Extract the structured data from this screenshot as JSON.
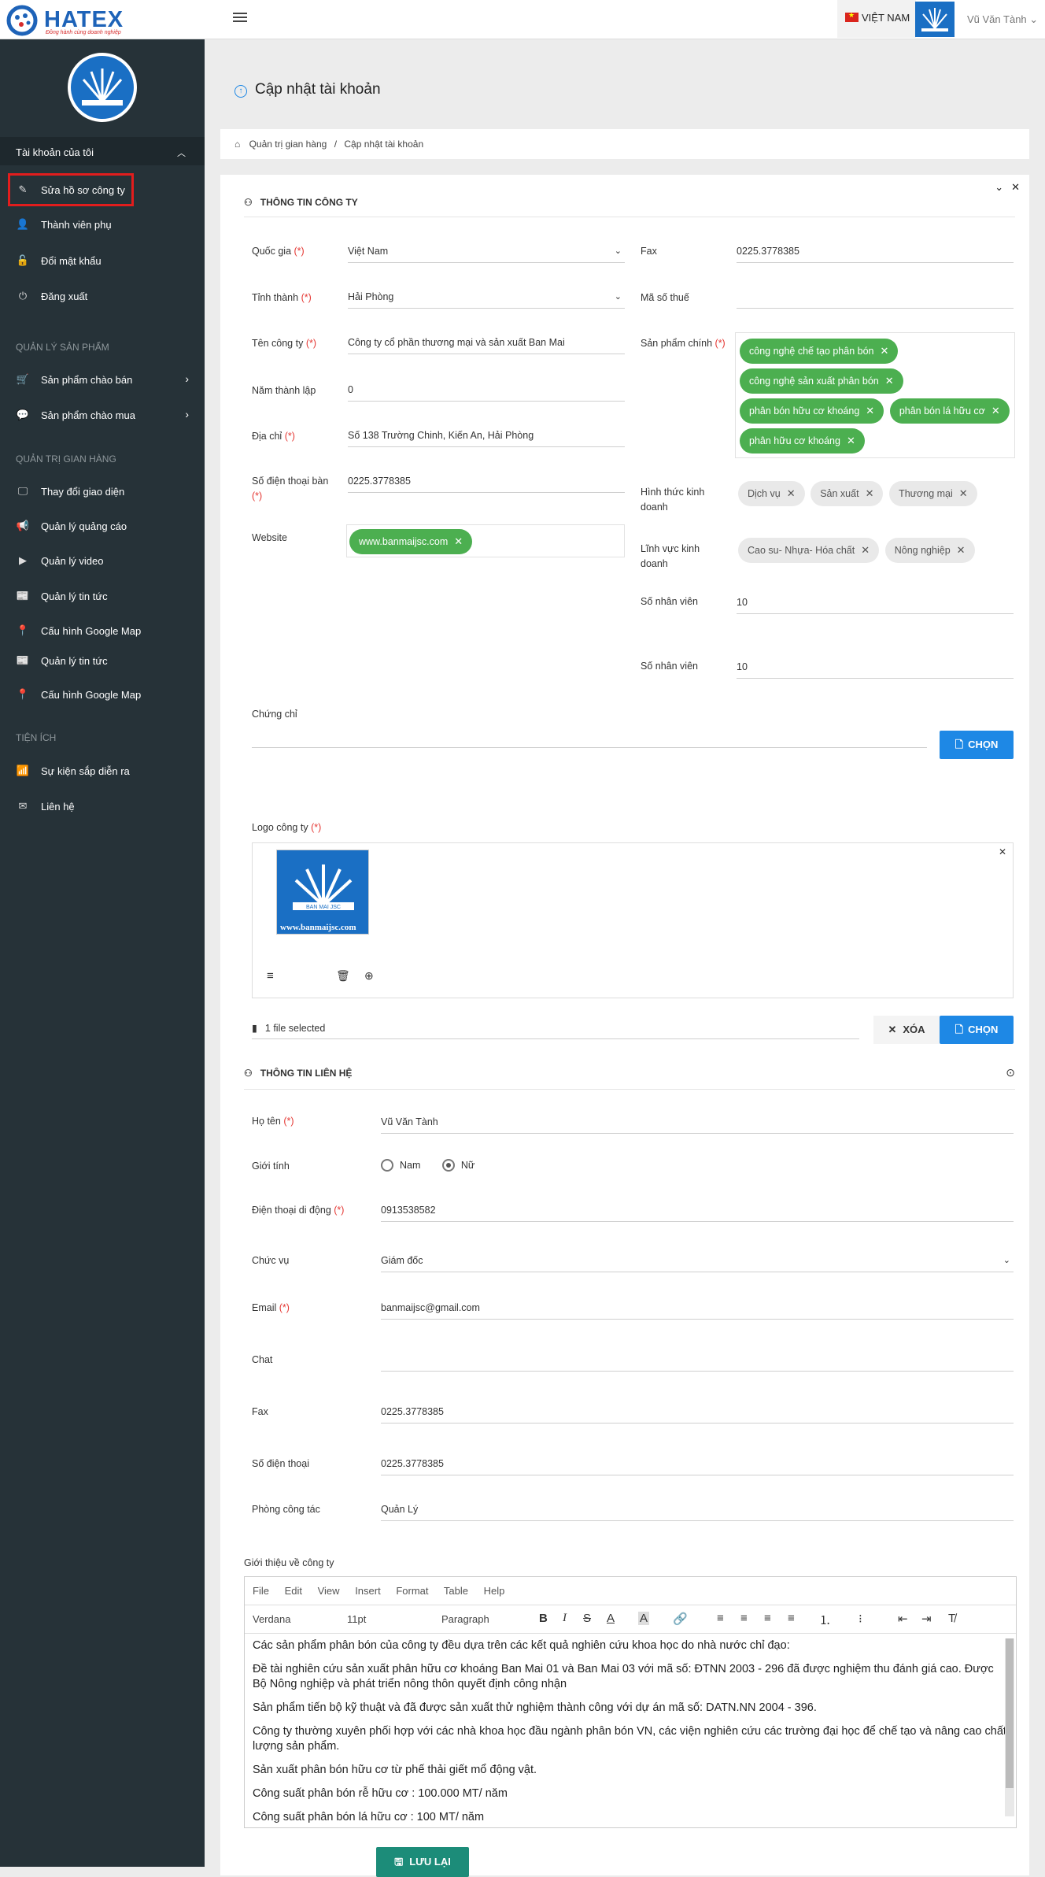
{
  "header": {
    "brand": "HATEX",
    "slogan": "Đồng hành cùng doanh nghiệp",
    "language": "VIỆT NAM",
    "user": "Vũ Văn Tành ⌄"
  },
  "sidebar": {
    "account_title": "Tài khoản của tôi",
    "account_items": [
      "Sửa hồ sơ công ty",
      "Thành viên phụ",
      "Đổi mật khẩu",
      "Đăng xuất"
    ],
    "section_products": "QUẢN LÝ SẢN PHẨM",
    "product_items": [
      "Sản phẩm chào bán",
      "Sản phẩm chào mua"
    ],
    "section_shop": "QUẢN TRỊ GIAN HÀNG",
    "shop_items": [
      "Thay đổi giao diện",
      "Quản lý quảng cáo",
      "Quản lý video",
      "Quản lý tin tức",
      "Cấu hình Google Map",
      "Quản lý tin tức",
      "Cấu hình Google Map"
    ],
    "section_utils": "TIỆN ÍCH",
    "util_items": [
      "Sự kiện sắp diễn ra",
      "Liên hệ"
    ]
  },
  "page": {
    "title": "Cập nhật tài khoản",
    "breadcrumb_home": "Quản trị gian hàng",
    "breadcrumb_sep": "/",
    "breadcrumb_current": "Cập nhật tài khoản"
  },
  "company": {
    "section_title": "THÔNG TIN CÔNG TY",
    "country_label": "Quốc gia",
    "country": "Việt Nam",
    "province_label": "Tỉnh thành",
    "province": "Hải Phòng",
    "name_label": "Tên công ty",
    "name": "Công ty cổ phần thương mại và sản xuất Ban Mai",
    "year_label": "Năm thành lập",
    "year": "0",
    "address_label": "Địa chỉ",
    "address": "Số 138 Trường Chinh, Kiến An, Hải Phòng",
    "phone_label": "Số điện thoại bàn",
    "phone": "0225.3778385",
    "website_label": "Website",
    "website": "www.banmaijsc.com",
    "fax_label": "Fax",
    "fax": "0225.3778385",
    "tax_label": "Mã số thuế",
    "tax": "",
    "main_products_label": "Sản phẩm chính",
    "main_products": [
      "công nghệ chế tạo phân bón",
      "công nghệ sản xuất phân bón",
      "phân bón hữu cơ khoáng",
      "phân bón lá hữu cơ",
      "phân hữu cơ khoáng"
    ],
    "business_form_label": "Hình thức kinh doanh",
    "business_forms": [
      "Dịch vụ",
      "Sản xuất",
      "Thương mại"
    ],
    "field_label": "Lĩnh vực kinh doanh",
    "fields": [
      "Cao su- Nhựa- Hóa chất",
      "Nông nghiệp"
    ],
    "staff_label": "Số nhân viên",
    "staff": "10",
    "staff2_label": "Số nhân viên",
    "staff2": "10",
    "cert_label": "Chứng chỉ",
    "choose": "CHỌN",
    "logo_label": "Logo công ty",
    "logo_site": "www.banmaijsc.com",
    "logo_text": "BAN MAI JSC",
    "file_selected": "1 file selected",
    "delete": "XÓA"
  },
  "contact": {
    "section_title": "THÔNG TIN LIÊN HỆ",
    "fullname_label": "Họ tên",
    "fullname": "Vũ Văn Tành",
    "gender_label": "Giới tính",
    "male": "Nam",
    "female": "Nữ",
    "mobile_label": "Điện thoại di động",
    "mobile": "0913538582",
    "position_label": "Chức vụ",
    "position": "Giám đốc",
    "email_label": "Email",
    "email": "banmaijsc@gmail.com",
    "chat_label": "Chat",
    "chat": "",
    "fax_label": "Fax",
    "fax": "0225.3778385",
    "phone_label": "Số điện thoại",
    "phone": "0225.3778385",
    "dept_label": "Phòng công tác",
    "dept": "Quản Lý"
  },
  "intro": {
    "label": "Giới thiệu về công ty",
    "menus": [
      "File",
      "Edit",
      "View",
      "Insert",
      "Format",
      "Table",
      "Help"
    ],
    "font": "Verdana",
    "size": "11pt",
    "block": "Paragraph",
    "paragraphs": [
      "Các sản phẩm phân bón của công ty đều dựa trên các kết quả nghiên cứu khoa học do nhà nước chỉ đạo:",
      "Đề tài nghiên cứu sản xuất phân hữu cơ khoáng Ban Mai 01 và Ban Mai 03 với mã số: ĐTNN 2003 - 296 đã được nghiệm thu đánh giá cao. Được Bộ Nông nghiệp và phát triển nông thôn quyết định công nhận",
      "Sản phẩm tiến bộ kỹ thuật và đã được sản xuất thử nghiệm thành công với dự án mã số: DATN.NN 2004 - 396.",
      "Công ty thường xuyên phối hợp với các nhà khoa học đầu ngành phân bón VN, các viện  nghiên cứu các trường đại học để chế tạo và nâng cao chất lượng sản phẩm.",
      "Sản xuất phân bón hữu cơ từ phế thải giết mổ động vật.",
      "Công suất phân bón rễ hữu cơ : 100.000 MT/ năm",
      "Công suất phân bón lá hữu cơ : 100 MT/ năm"
    ]
  },
  "save": "LƯU LẠI"
}
